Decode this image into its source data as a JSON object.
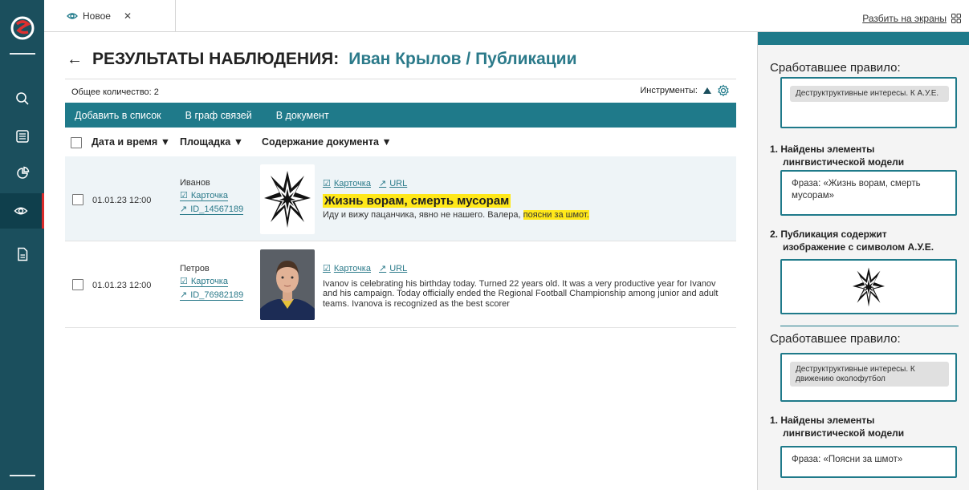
{
  "tabs": [
    {
      "label": "Новое"
    }
  ],
  "split_label": "Разбить на экраны",
  "header": {
    "title": "РЕЗУЛЬТАТЫ НАБЛЮДЕНИЯ:",
    "subtitle": "Иван Крылов / Публикации"
  },
  "count_label": "Общее количество: 2",
  "tools_label": "Инструменты:",
  "actions": [
    "Добавить в список",
    "В граф связей",
    "В документ"
  ],
  "columns": [
    "Дата и время",
    "Площадка",
    "Содержание документа"
  ],
  "rows": [
    {
      "date": "01.01.23 12:00",
      "author": "Иванов",
      "card_link": "Карточка",
      "id_link": "ID_14567189",
      "links": [
        "Карточка",
        "URL"
      ],
      "title": "Жизнь ворам, смерть мусорам",
      "body": "Иду и вижу пацанчика, явно не нашего. Валера,",
      "body_highlight": "поясни за шмот."
    },
    {
      "date": "01.01.23 12:00",
      "author": "Петров",
      "card_link": "Карточка",
      "id_link": "ID_76982189",
      "links": [
        "Карточка",
        "URL"
      ],
      "body": "Ivanov is celebrating his birthday today. Turned 22 years old. It was a very productive year for Ivanov and his campaign. Today officially ended the Regional Football Championship among junior and adult teams. Ivanova is recognized as the best scorer"
    }
  ],
  "right_panel": {
    "rule_label": "Сработавшее правило:",
    "rule1_tag": "Деструктруктивные интересы. К А.У.Е.",
    "step1": "1. Найдены элементы",
    "step1_cont": "лингвистической модели",
    "phrase1": "Фраза: «Жизнь ворам, смерть мусорам»",
    "step2": "2. Публикация содержит",
    "step2_cont": "изображение с символом А.У.Е.",
    "rule2_tag": "Деструктруктивные интересы. К движению околофутбол",
    "step3": "1. Найдены элементы",
    "step3_cont": "лингвистической модели",
    "phrase2": "Фраза: «Поясни за шмот»"
  },
  "colors": {
    "rail": "#1b4f5d",
    "accent": "#1f7a8a",
    "highlight": "#ffe81a",
    "active_marker": "#d92b2b"
  },
  "icons": [
    "logo-icon",
    "search-icon",
    "list-icon",
    "pie-chart-icon",
    "eye-icon",
    "document-icon"
  ]
}
